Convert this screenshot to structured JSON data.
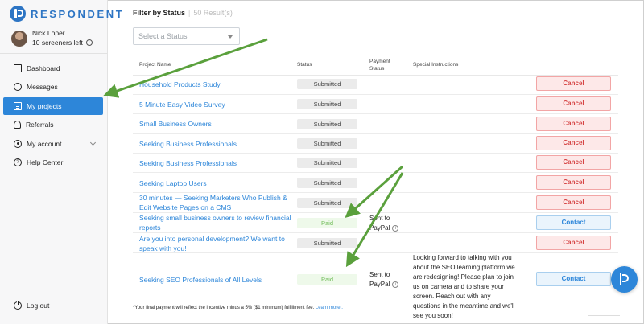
{
  "brand": {
    "name": "RESPONDENT",
    "color": "#2d75c4"
  },
  "user": {
    "name": "Nick Loper",
    "screeners_left": "10 screeners left"
  },
  "nav": {
    "items": [
      {
        "label": "Dashboard",
        "icon": "dashboard-icon",
        "active": false
      },
      {
        "label": "Messages",
        "icon": "chat-bubble-icon",
        "active": false
      },
      {
        "label": "My projects",
        "icon": "projects-icon",
        "active": true
      },
      {
        "label": "Referrals",
        "icon": "people-icon",
        "active": false
      },
      {
        "label": "My account",
        "icon": "account-gear-icon",
        "active": false
      },
      {
        "label": "Help Center",
        "icon": "help-icon",
        "active": false
      }
    ],
    "logout_label": "Log out"
  },
  "filter": {
    "title": "Filter by Status",
    "result_count": "50 Result(s)",
    "select_placeholder": "Select a Status"
  },
  "table": {
    "headers": {
      "project_name": "Project Name",
      "status": "Status",
      "payment_status": "Payment Status",
      "special_instructions": "Special Instructions"
    },
    "rows": [
      {
        "name": "Household Products Study",
        "status": "Submitted",
        "payment": "",
        "instructions": "",
        "action": "Cancel"
      },
      {
        "name": "5 Minute Easy Video Survey",
        "status": "Submitted",
        "payment": "",
        "instructions": "",
        "action": "Cancel"
      },
      {
        "name": "Small Business Owners",
        "status": "Submitted",
        "payment": "",
        "instructions": "",
        "action": "Cancel"
      },
      {
        "name": "Seeking Business Professionals",
        "status": "Submitted",
        "payment": "",
        "instructions": "",
        "action": "Cancel"
      },
      {
        "name": "Seeking Business Professionals",
        "status": "Submitted",
        "payment": "",
        "instructions": "",
        "action": "Cancel"
      },
      {
        "name": "Seeking Laptop Users",
        "status": "Submitted",
        "payment": "",
        "instructions": "",
        "action": "Cancel"
      },
      {
        "name": "30 minutes — Seeking Marketers Who Publish & Edit Website Pages on a CMS",
        "status": "Submitted",
        "payment": "",
        "instructions": "",
        "action": "Cancel"
      },
      {
        "name": "Seeking small business owners to review financial reports",
        "status": "Paid",
        "payment": "Sent to PayPal",
        "instructions": "",
        "action": "Contact"
      },
      {
        "name": "Are you into personal development? We want to speak with you!",
        "status": "Submitted",
        "payment": "",
        "instructions": "",
        "action": "Cancel"
      },
      {
        "name": "Seeking SEO Professionals of All Levels",
        "status": "Paid",
        "payment": "Sent to PayPal",
        "instructions": "Looking forward to talking with you about the SEO learning platform we are redesigning! Please plan to join us on camera and to share your screen. Reach out with any questions in the meantime and we'll see you soon!",
        "action": "Contact"
      }
    ]
  },
  "footnote": {
    "text": "*Your final payment will reflect the incentive minus a 5% ($1 minimum) fulfillment fee.",
    "link": "Learn more ."
  },
  "colors": {
    "accent": "#2d86d9",
    "annotation_arrow": "#5aa03c",
    "cancel": "#d64545",
    "paid": "#6dbb55"
  }
}
